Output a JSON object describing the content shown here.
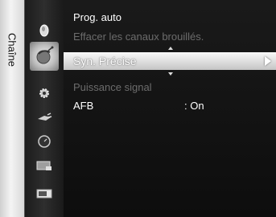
{
  "sidebar": {
    "label": "Chaîne",
    "icons": [
      {
        "name": "picture-icon"
      },
      {
        "name": "channel-icon",
        "selected": true
      },
      {
        "name": "setup-icon"
      },
      {
        "name": "input-icon"
      },
      {
        "name": "clock-icon"
      },
      {
        "name": "application-icon"
      },
      {
        "name": "support-icon"
      }
    ]
  },
  "menu": {
    "items": [
      {
        "label": "Prog. auto",
        "state": "normal"
      },
      {
        "label": "Effacer les canaux brouillés.",
        "state": "disabled"
      },
      {
        "label": "Syn. Précise",
        "state": "selected"
      },
      {
        "label": "Puissance signal",
        "state": "disabled"
      },
      {
        "label": "AFB",
        "value": ": On",
        "state": "normal"
      }
    ]
  },
  "colors": {
    "selected_highlight": "#e2e2e2",
    "disabled_text": "#6c6c6c",
    "text": "#ffffff"
  }
}
